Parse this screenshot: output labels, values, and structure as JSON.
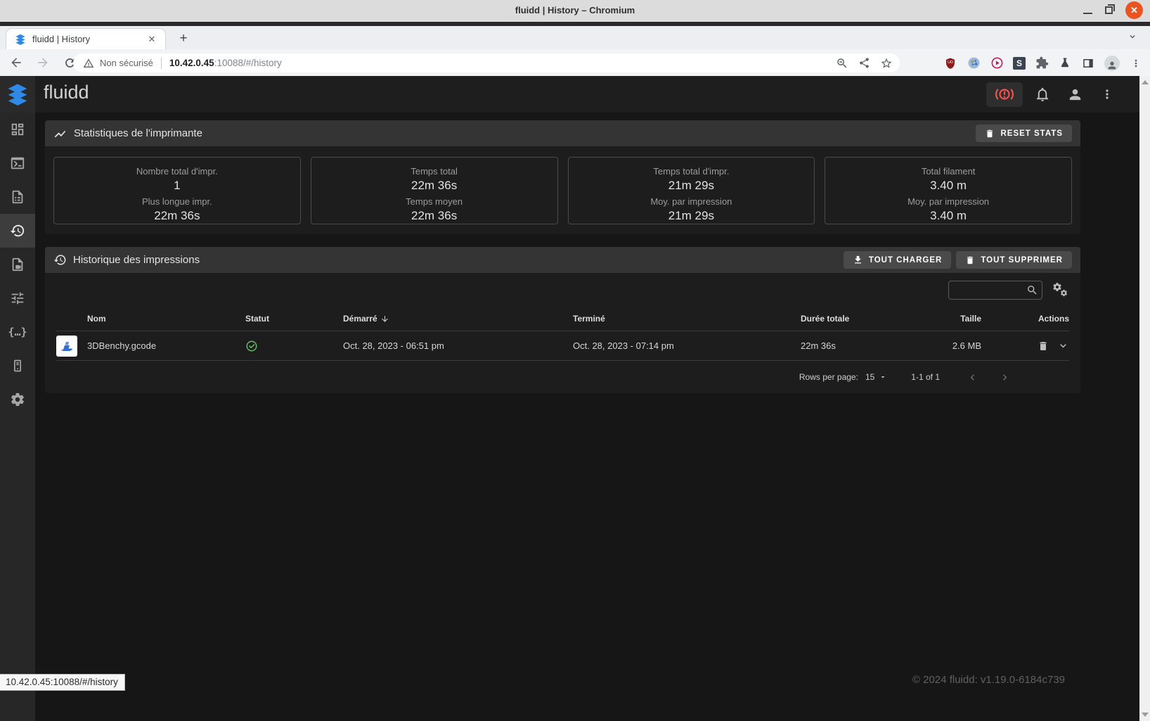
{
  "browser": {
    "window_title": "fluidd | History – Chromium",
    "tab_title": "fluidd | History",
    "security_label": "Non sécurisé",
    "url_host": "10.42.0.45",
    "url_rest": ":10088/#/history",
    "status_bar_url": "10.42.0.45:10088/#/history",
    "extension_s_label": "S"
  },
  "glyphs": {
    "close_x": "✕",
    "plus": "+",
    "macros": "{…}"
  },
  "colors": {
    "logo_blue": "#2e8ae6",
    "estop_red": "#ef5350",
    "success_green": "#66bb6a",
    "close_button_orange": "#e95420",
    "ublock_red": "#8a1c1c"
  },
  "app": {
    "title": "fluidd"
  },
  "stats": {
    "header": "Statistiques de l'imprimante",
    "reset_button": "RESET STATS",
    "boxes": [
      {
        "label1": "Nombre total d'impr.",
        "value1": "1",
        "label2": "Plus longue impr.",
        "value2": "22m 36s"
      },
      {
        "label1": "Temps total",
        "value1": "22m 36s",
        "label2": "Temps moyen",
        "value2": "22m 36s"
      },
      {
        "label1": "Temps total d'impr.",
        "value1": "21m 29s",
        "label2": "Moy. par impression",
        "value2": "21m 29s"
      },
      {
        "label1": "Total filament",
        "value1": "3.40 m",
        "label2": "Moy. par impression",
        "value2": "3.40 m"
      }
    ]
  },
  "history": {
    "header": "Historique des impressions",
    "load_all_button": "TOUT CHARGER",
    "delete_all_button": "TOUT SUPPRIMER",
    "columns": [
      "Nom",
      "Statut",
      "Démarré",
      "Terminé",
      "Durée totale",
      "Taille",
      "Actions"
    ],
    "rows": [
      {
        "name": "3DBenchy.gcode",
        "status": "success",
        "started": "Oct. 28, 2023 - 06:51 pm",
        "finished": "Oct. 28, 2023 - 07:14 pm",
        "duration": "22m 36s",
        "size": "2.6 MB"
      }
    ],
    "pagination": {
      "rows_per_page_label": "Rows per page:",
      "rows_per_page": "15",
      "range": "1-1 of 1"
    }
  },
  "footer": {
    "copyright": "© 2024 fluidd: v1.19.0-6184c739"
  }
}
